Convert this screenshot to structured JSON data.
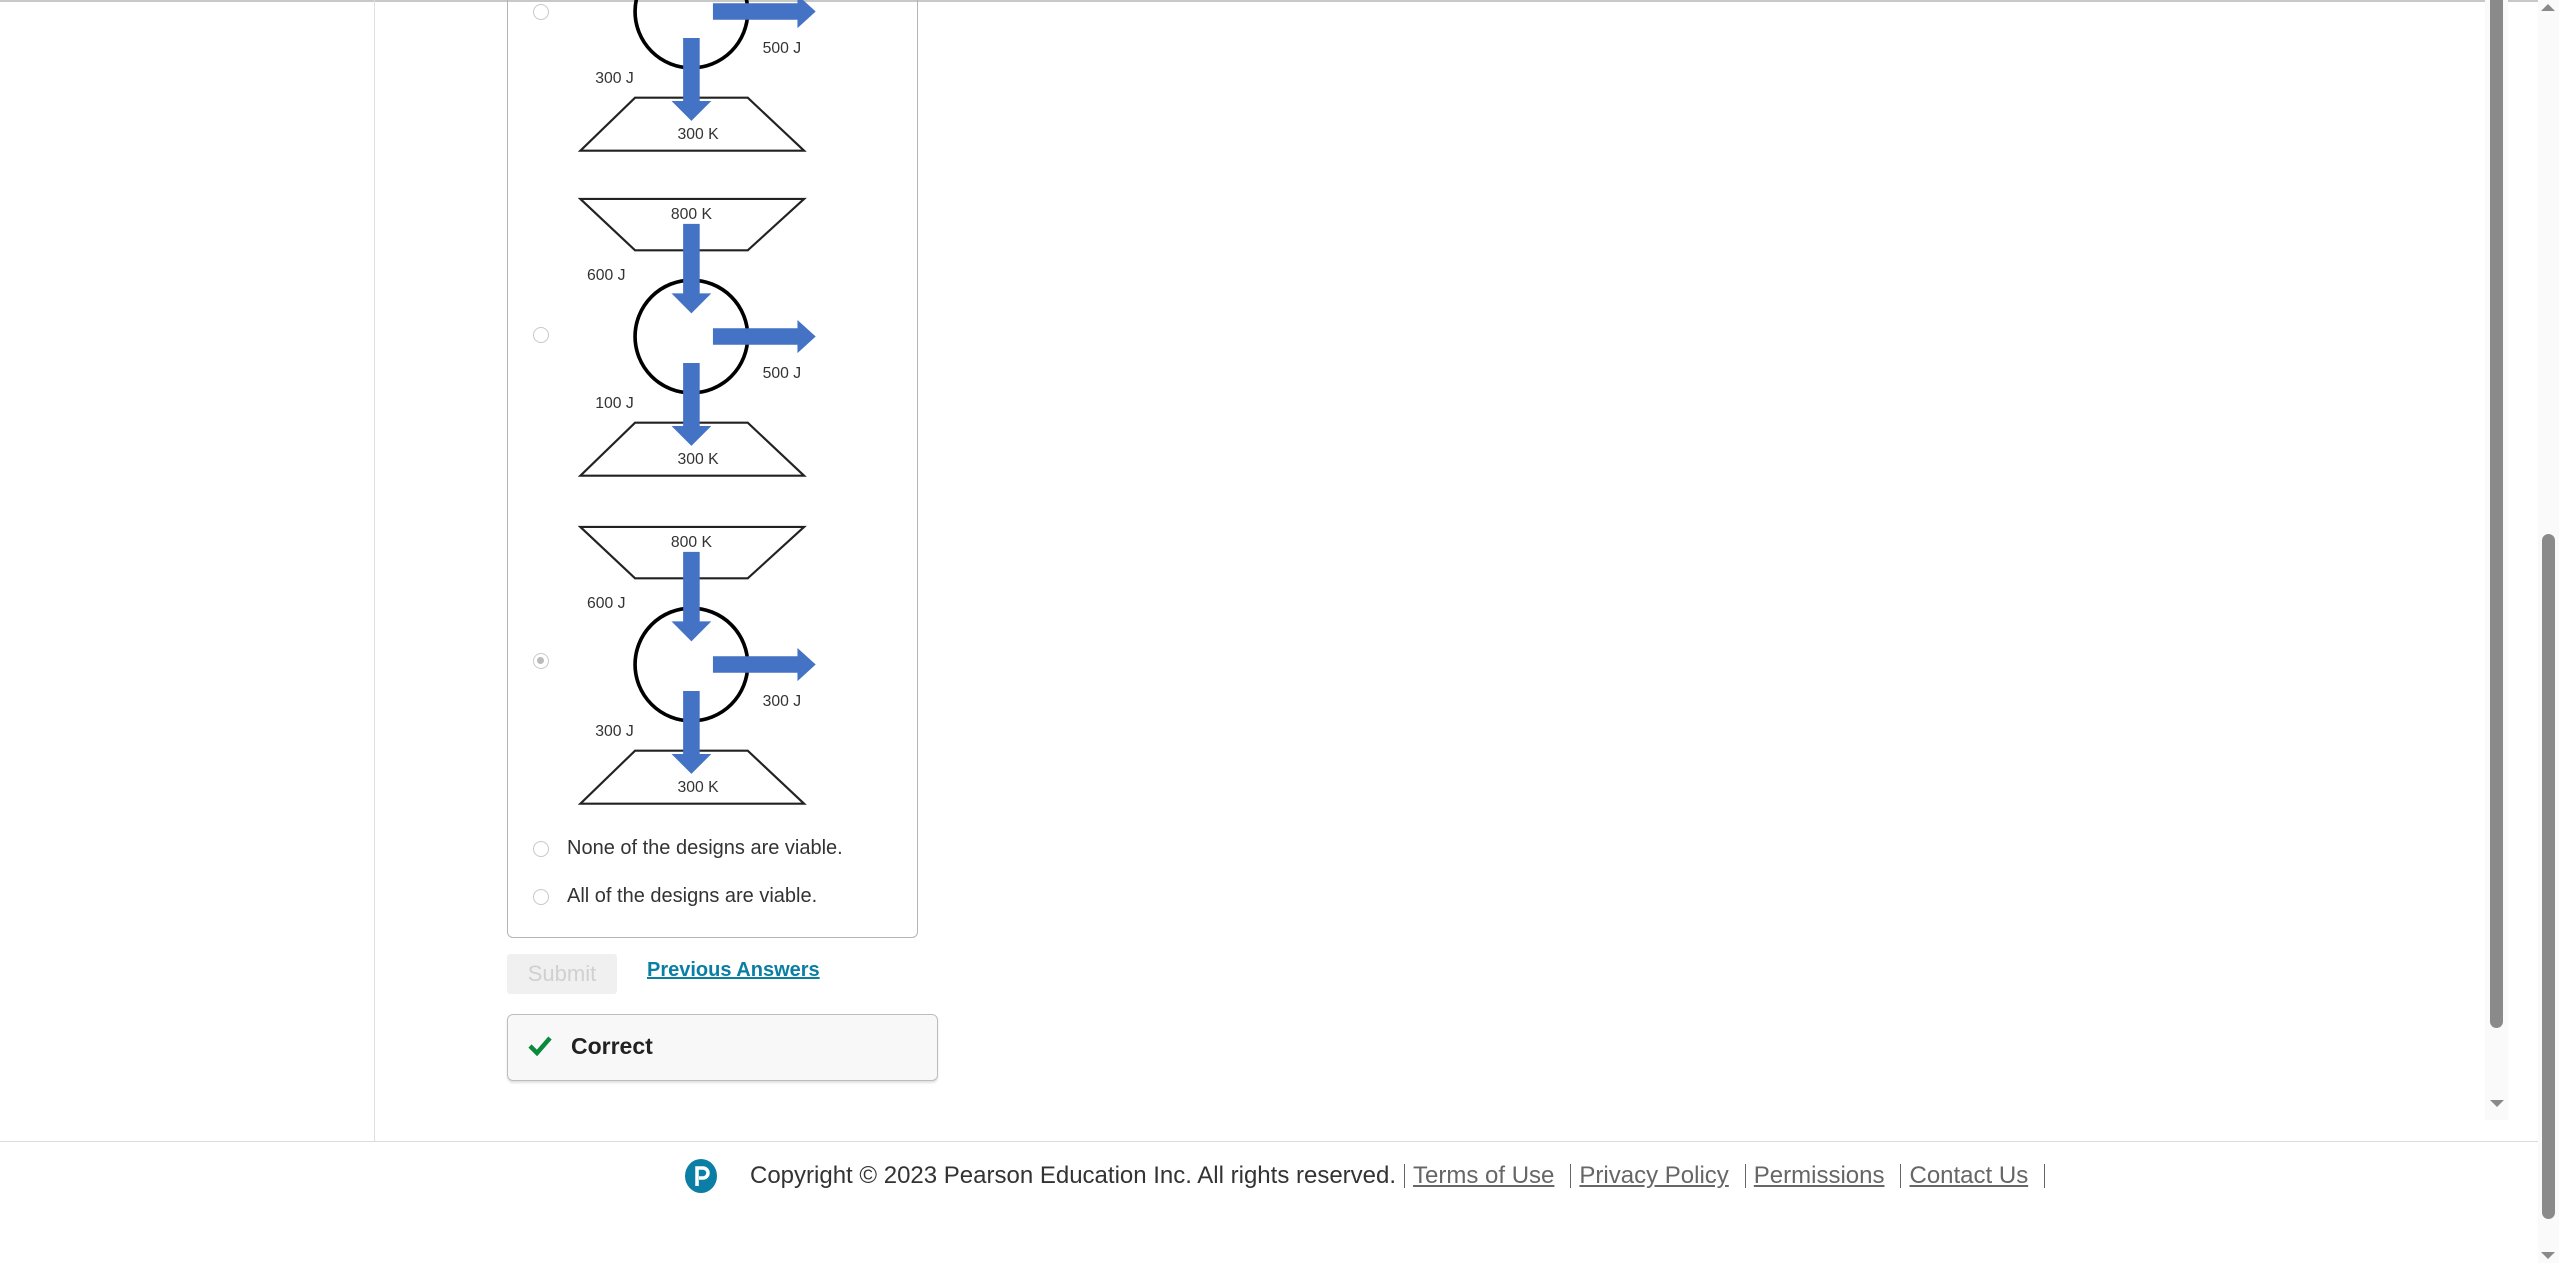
{
  "question": {
    "options": [
      {
        "type": "diagram",
        "hot": "",
        "q_hot": "",
        "work": "500 J",
        "q_cold": "300 J",
        "cold": "300 K",
        "selected": false
      },
      {
        "type": "diagram",
        "hot": "800 K",
        "q_hot": "600 J",
        "work": "500 J",
        "q_cold": "100 J",
        "cold": "300 K",
        "selected": false
      },
      {
        "type": "diagram",
        "hot": "800 K",
        "q_hot": "600 J",
        "work": "300 J",
        "q_cold": "300 J",
        "cold": "300 K",
        "selected": true
      },
      {
        "type": "text",
        "label": "None of the designs are viable.",
        "selected": false
      },
      {
        "type": "text",
        "label": "All of the designs are viable.",
        "selected": false
      }
    ],
    "arrow_color": "#4472c4"
  },
  "actions": {
    "submit_label": "Submit",
    "previous_answers_label": "Previous Answers"
  },
  "feedback": {
    "label": "Correct",
    "icon": "checkmark-icon",
    "color": "#0a8a3a"
  },
  "footer": {
    "copyright": "Copyright © 2023  Pearson Education Inc. All rights reserved.",
    "links": [
      "Terms of Use",
      "Privacy Policy",
      "Permissions",
      "Contact Us"
    ],
    "logo": "pearson-logo",
    "brand_color": "#0a7ea4"
  }
}
